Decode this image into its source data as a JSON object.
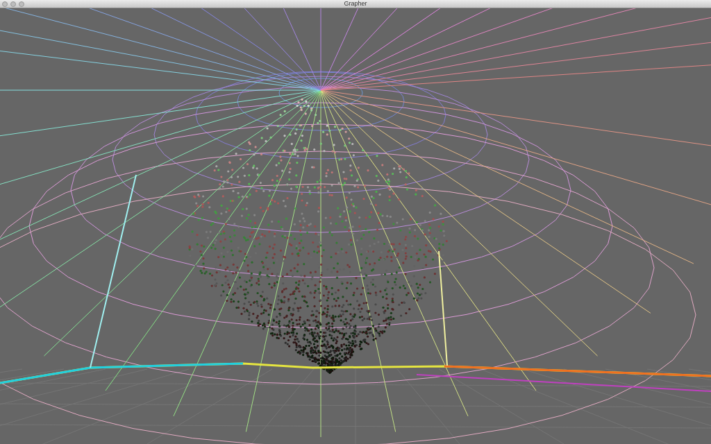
{
  "window": {
    "title": "Grapher"
  }
}
